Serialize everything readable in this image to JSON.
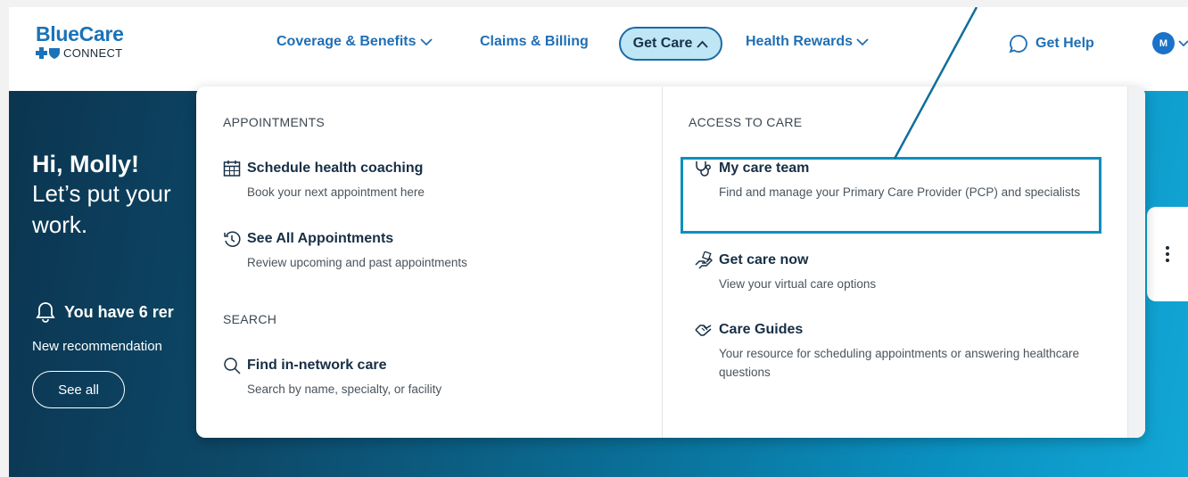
{
  "logo": {
    "title": "BlueCare",
    "subtitle": "CONNECT"
  },
  "nav": {
    "coverage": "Coverage & Benefits",
    "claims": "Claims & Billing",
    "get_care": "Get Care",
    "health_rewards": "Health Rewards",
    "help": "Get Help",
    "avatar_initial": "M"
  },
  "hero": {
    "greeting": "Hi, Molly!",
    "message": "Let’s put your",
    "message_line2": "work.",
    "reminders": "You have 6 rer",
    "reminders_sub": "New recommendation",
    "see_all": "See all"
  },
  "menu": {
    "appointments": {
      "heading": "APPOINTMENTS",
      "items": [
        {
          "title": "Schedule health coaching",
          "desc": "Book your next appointment here",
          "icon": "calendar-icon"
        },
        {
          "title": "See All Appointments",
          "desc": "Review upcoming and past appointments",
          "icon": "history-icon"
        }
      ]
    },
    "search": {
      "heading": "SEARCH",
      "items": [
        {
          "title": "Find in-network care",
          "desc": "Search by name, specialty, or facility",
          "icon": "search-icon"
        }
      ]
    },
    "access": {
      "heading": "ACCESS TO CARE",
      "items": [
        {
          "title": "My care team",
          "desc": "Find and manage your Primary Care Provider (PCP) and specialists",
          "icon": "stethoscope-icon"
        },
        {
          "title": "Get care now",
          "desc": "View your virtual care options",
          "icon": "hand-care-icon"
        },
        {
          "title": "Care Guides",
          "desc": "Your resource for scheduling appointments or answering healthcare questions",
          "icon": "handshake-icon"
        }
      ]
    }
  },
  "colors": {
    "brand": "#1a73b8",
    "highlight": "#0d8fbd",
    "pill_bg": "#bfe6f5"
  }
}
